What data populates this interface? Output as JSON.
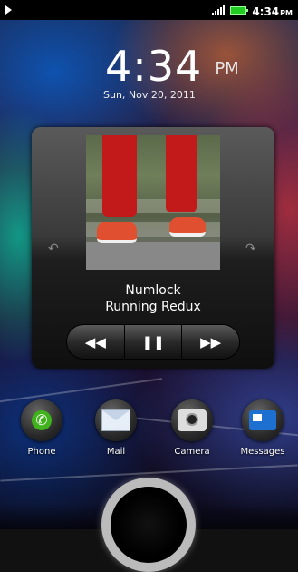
{
  "status_bar": {
    "time": "4:34",
    "ampm": "PM"
  },
  "clock": {
    "time": "4:34",
    "ampm": "PM",
    "date": "Sun, Nov 20, 2011"
  },
  "music": {
    "track_title": "Numlock",
    "artist": "Running Redux",
    "controls": {
      "previous": "◀◀",
      "play_pause": "❚❚",
      "next": "▶▶"
    }
  },
  "dock": [
    {
      "label": "Phone",
      "icon": "phone-icon"
    },
    {
      "label": "Mail",
      "icon": "mail-icon"
    },
    {
      "label": "Camera",
      "icon": "camera-icon"
    },
    {
      "label": "Messages",
      "icon": "messages-icon"
    }
  ],
  "colors": {
    "phone_green": "#3fb21c",
    "battery_green": "#22cc22"
  }
}
